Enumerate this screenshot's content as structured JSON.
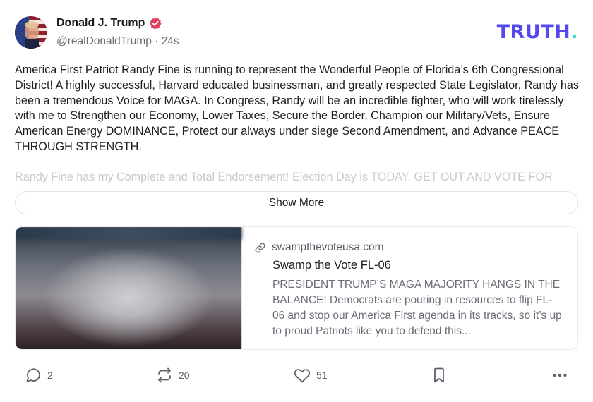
{
  "author": {
    "name": "Donald J. Trump",
    "handle": "@realDonaldTrump",
    "time": "24s",
    "verified_icon": "verified-badge-icon",
    "verified_color": "#e0405c"
  },
  "brand": {
    "logo_main": "TRUTH",
    "logo_dot": ".",
    "color": "#5448ee",
    "dot_color": "#35d4c7"
  },
  "post": {
    "body": "America First Patriot Randy Fine is running to represent the Wonderful People of Florida’s 6th Congressional District! A highly successful, Harvard educated businessman, and greatly respected State Legislator, Randy has been a tremendous Voice for MAGA. In Congress, Randy will be an incredible fighter, who will work tirelessly with me to Strengthen our Economy, Lower Taxes, Secure the Border, Champion our Military/Vets, Ensure American Energy DOMINANCE, Protect our always under siege Second Amendment, and Advance PEACE THROUGH STRENGTH.",
    "faded_line": "Randy Fine has my Complete and Total Endorsement! Election Day is TODAY. GET OUT AND VOTE FOR",
    "show_more_label": "Show More"
  },
  "link_card": {
    "domain": "swampthevoteusa.com",
    "title": "Swamp the Vote FL-06",
    "description": "PRESIDENT TRUMP’S MAGA MAJORITY HANGS IN THE BALANCE! Democrats are pouring in resources to flip FL-06 and stop our America First agenda in its tracks, so it’s up to proud Patriots like you to defend this..."
  },
  "actions": {
    "replies": "2",
    "retruths": "20",
    "likes": "51"
  }
}
